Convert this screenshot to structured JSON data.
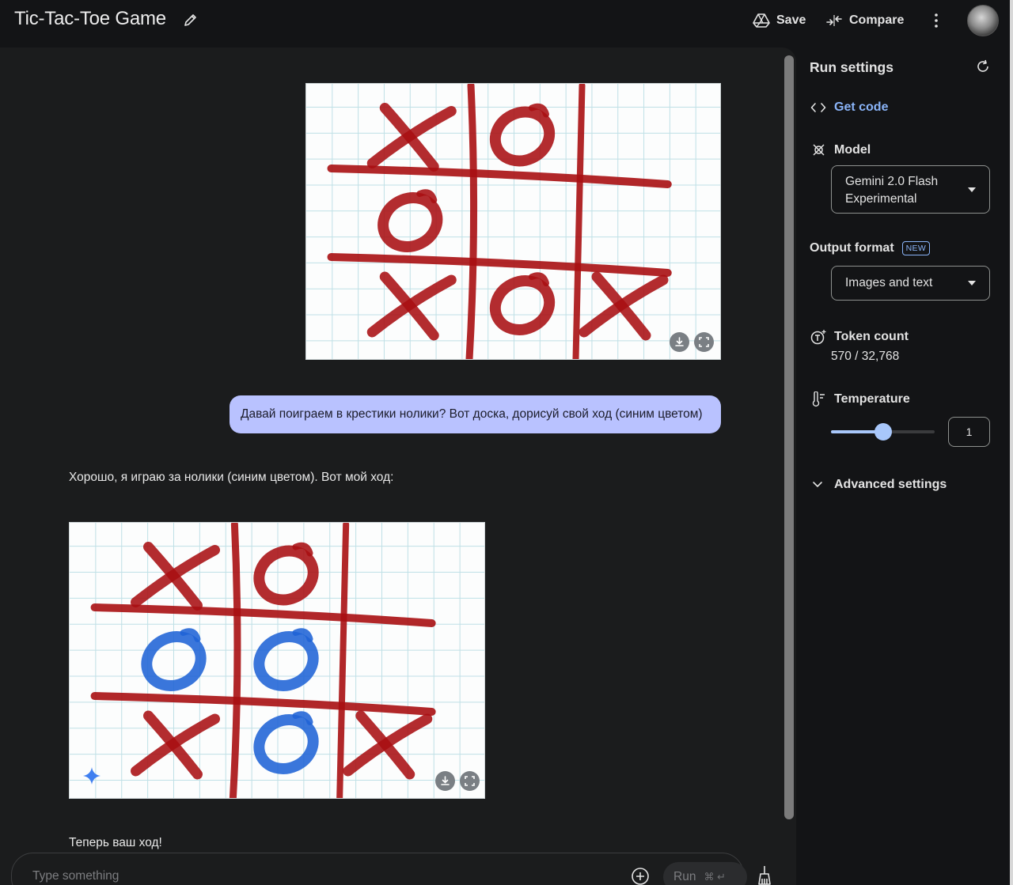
{
  "header": {
    "title": "Tic-Tac-Toe Game",
    "save_label": "Save",
    "compare_label": "Compare"
  },
  "chat": {
    "user_message": "Давай поиграем в крестики нолики? Вот доска, дорисуй свой ход (синим цветом)",
    "model_reply_intro": "Хорошо, я играю за нолики (синим цветом). Вот мой ход:",
    "model_reply_outro": "Теперь ваш ход!",
    "board_before": [
      "X",
      "O",
      "",
      "O",
      "",
      "",
      "X",
      "O",
      "X"
    ],
    "board_after": [
      "X",
      "O",
      "",
      "O",
      "O",
      "",
      "X",
      "O",
      "X"
    ],
    "board_after_blue_cells": [
      3,
      4,
      7
    ]
  },
  "composer": {
    "placeholder": "Type something",
    "run_label": "Run",
    "run_shortcut": "⌘ ↵"
  },
  "settings": {
    "title": "Run settings",
    "get_code_label": "Get code",
    "model_label": "Model",
    "model_value_line1": "Gemini 2.0 Flash",
    "model_value_line2": "Experimental",
    "output_format_label": "Output format",
    "new_badge": "NEW",
    "output_format_value": "Images and text",
    "token_count_label": "Token count",
    "token_count_value": "570 / 32,768",
    "temperature_label": "Temperature",
    "temperature_value": "1",
    "temperature_fraction": 0.5,
    "advanced_label": "Advanced settings"
  },
  "colors": {
    "accent": "#8ab4f8",
    "bubble": "#b9c2ff",
    "ink_red": "#a80f12",
    "ink_blue": "#1f63d6"
  }
}
